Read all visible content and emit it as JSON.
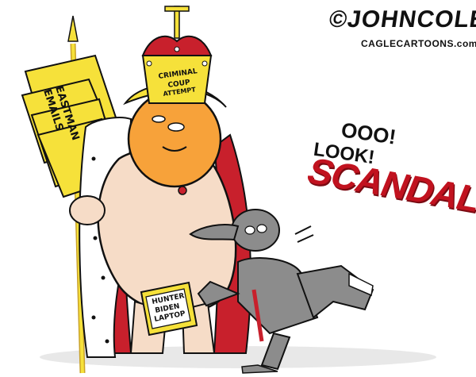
{
  "signature": {
    "name": "©JOHNCOLE",
    "site": "CAGLECARTOONS.com"
  },
  "speech": {
    "line1": "OOO!",
    "line2": "LOOK!",
    "exclaim": "SCANDAL!"
  },
  "crown_label": {
    "line1": "CRIMINAL",
    "line2": "COUP",
    "line3": "ATTEMPT"
  },
  "papers_label": {
    "line1": "EASTMAN",
    "line2": "EMAILS"
  },
  "laptop_label": {
    "line1": "HUNTER",
    "line2": "BIDEN",
    "line3": "LAPTOP"
  },
  "colors": {
    "skin": "#f6dcc7",
    "face": "#f7a23a",
    "gold": "#f6e13a",
    "robe_red": "#c8202c",
    "suit": "#8c8c8c",
    "scandal_red": "#c1121f"
  }
}
